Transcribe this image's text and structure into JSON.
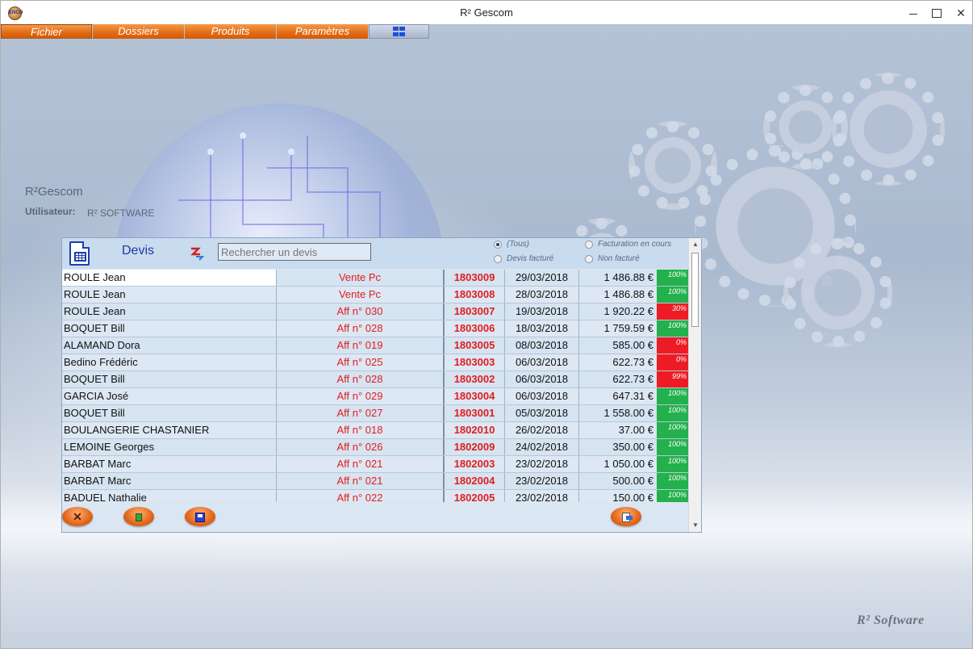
{
  "window": {
    "title": "R² Gescom",
    "icon_text": "ENCO"
  },
  "menu": [
    {
      "label": "Fichier"
    },
    {
      "label": "Dossiers"
    },
    {
      "label": "Produits"
    },
    {
      "label": "Paramètres"
    }
  ],
  "app": {
    "name": "R²Gescom",
    "user_label": "Utilisateur:",
    "user_value": "R² SOFTWARE"
  },
  "devis": {
    "title": "Devis",
    "search_placeholder": "Rechercher un devis",
    "filters": {
      "tous": "(Tous)",
      "facturation_en_cours": "Facturation en cours",
      "devis_facture": "Devis facturé",
      "non_facture": "Non facturé",
      "selected": "tous"
    },
    "rows": [
      {
        "client": "ROULE Jean",
        "affaire": "Vente Pc",
        "numero": "1803009",
        "date": "29/03/2018",
        "montant": "1 486.88 €",
        "pct": "100%",
        "pct_color": "#22b14c"
      },
      {
        "client": "ROULE Jean",
        "affaire": "Vente Pc",
        "numero": "1803008",
        "date": "28/03/2018",
        "montant": "1 486.88 €",
        "pct": "100%",
        "pct_color": "#22b14c"
      },
      {
        "client": "ROULE Jean",
        "affaire": "Aff n° 030",
        "numero": "1803007",
        "date": "19/03/2018",
        "montant": "1 920.22 €",
        "pct": "30%",
        "pct_color": "#ed1c24"
      },
      {
        "client": "BOQUET Bill",
        "affaire": "Aff n° 028",
        "numero": "1803006",
        "date": "18/03/2018",
        "montant": "1 759.59 €",
        "pct": "100%",
        "pct_color": "#22b14c"
      },
      {
        "client": "ALAMAND Dora",
        "affaire": "Aff n° 019",
        "numero": "1803005",
        "date": "08/03/2018",
        "montant": "585.00 €",
        "pct": "0%",
        "pct_color": "#ed1c24"
      },
      {
        "client": "Bedino Frédéric",
        "affaire": "Aff n° 025",
        "numero": "1803003",
        "date": "06/03/2018",
        "montant": "622.73 €",
        "pct": "0%",
        "pct_color": "#ed1c24"
      },
      {
        "client": "BOQUET Bill",
        "affaire": "Aff n° 028",
        "numero": "1803002",
        "date": "06/03/2018",
        "montant": "622.73 €",
        "pct": "99%",
        "pct_color": "#ed1c24"
      },
      {
        "client": "GARCIA José",
        "affaire": "Aff n° 029",
        "numero": "1803004",
        "date": "06/03/2018",
        "montant": "647.31 €",
        "pct": "100%",
        "pct_color": "#22b14c"
      },
      {
        "client": "BOQUET Bill",
        "affaire": "Aff n° 027",
        "numero": "1803001",
        "date": "05/03/2018",
        "montant": "1 558.00 €",
        "pct": "100%",
        "pct_color": "#22b14c"
      },
      {
        "client": "BOULANGERIE CHASTANIER",
        "affaire": "Aff n° 018",
        "numero": "1802010",
        "date": "26/02/2018",
        "montant": "37.00 €",
        "pct": "100%",
        "pct_color": "#22b14c"
      },
      {
        "client": "LEMOINE Georges",
        "affaire": "Aff n° 026",
        "numero": "1802009",
        "date": "24/02/2018",
        "montant": "350.00 €",
        "pct": "100%",
        "pct_color": "#22b14c"
      },
      {
        "client": "BARBAT Marc",
        "affaire": "Aff n° 021",
        "numero": "1802003",
        "date": "23/02/2018",
        "montant": "1 050.00 €",
        "pct": "100%",
        "pct_color": "#22b14c"
      },
      {
        "client": "BARBAT Marc",
        "affaire": "Aff n° 021",
        "numero": "1802004",
        "date": "23/02/2018",
        "montant": "500.00 €",
        "pct": "100%",
        "pct_color": "#22b14c"
      },
      {
        "client": "BADUEL Nathalie",
        "affaire": "Aff n° 022",
        "numero": "1802005",
        "date": "23/02/2018",
        "montant": "150.00 €",
        "pct": "100%",
        "pct_color": "#22b14c"
      }
    ],
    "footer_buttons": [
      {
        "name": "delete-button",
        "icon": "close-icon"
      },
      {
        "name": "new-button",
        "icon": "document-icon"
      },
      {
        "name": "save-button",
        "icon": "save-icon"
      },
      {
        "name": "export-button",
        "icon": "export-icon"
      }
    ]
  },
  "brand": "R² Software",
  "colors": {
    "menu_orange": "#e46a14",
    "accent_blue": "#1c3aa0",
    "status_green": "#22b14c",
    "status_red": "#ed1c24"
  }
}
